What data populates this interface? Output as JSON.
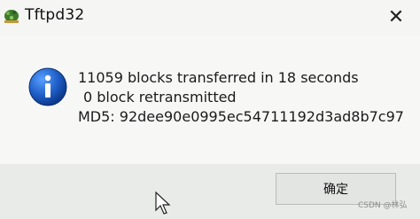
{
  "window": {
    "title": "Tftpd32",
    "close_glyph": "✕"
  },
  "dialog": {
    "icon": "information-icon",
    "lines": [
      "11059 blocks transferred in 18 seconds",
      "0 block retransmitted",
      "MD5: 92dee90e0995ec54711192d3ad8b7c97"
    ],
    "ok_label": "确定"
  },
  "watermark": "CSDN @林弘",
  "colors": {
    "info_blue": "#1f5fc8",
    "window_bg": "#f2f3f1"
  }
}
